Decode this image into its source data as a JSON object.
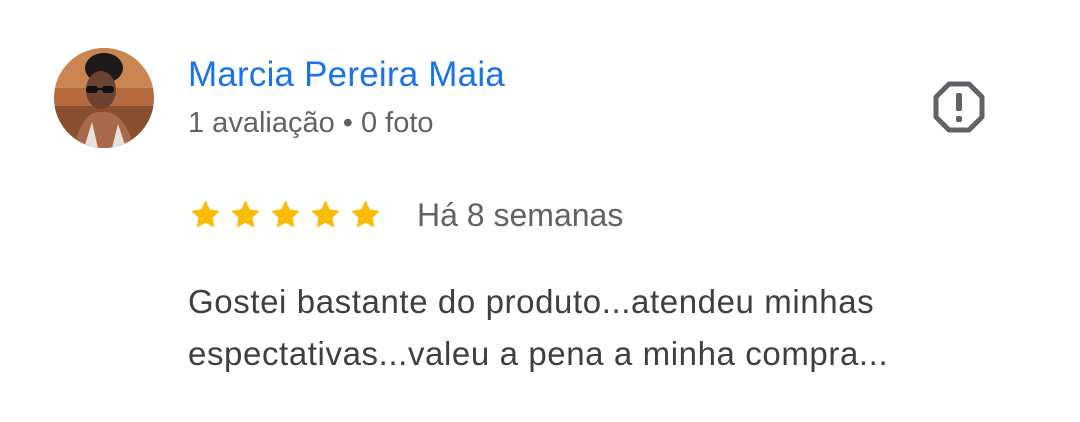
{
  "review": {
    "reviewer": {
      "name": "Marcia Pereira Maia",
      "review_count_label": "1 avaliação",
      "separator": "•",
      "photo_count_label": "0 foto",
      "avatar": "reviewer-avatar-photo"
    },
    "report_icon": "report-flag-octagon-icon",
    "rating": {
      "value": 5,
      "max": 5,
      "star_color": "#fbbc04"
    },
    "date": "Há 8 semanas",
    "text": "Gostei bastante do produto...atendeu minhas espectativas...valeu a pena a minha compra..."
  },
  "colors": {
    "name": "#1a73e8",
    "meta": "#5f6368",
    "body_text": "#3c4043",
    "icon": "#5f6368"
  }
}
